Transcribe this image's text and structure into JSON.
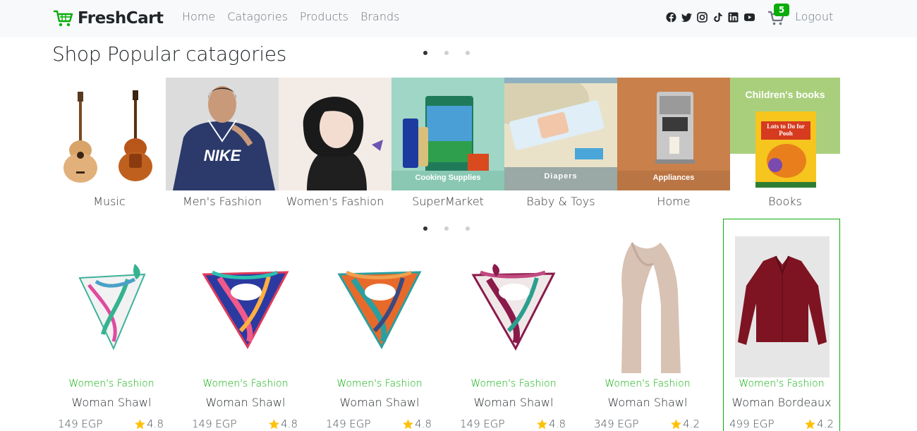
{
  "brand": {
    "name": "FreshCart"
  },
  "nav": {
    "links": [
      "Home",
      "Catagories",
      "Products",
      "Brands"
    ],
    "logout": "Logout"
  },
  "social_icons": [
    "facebook-icon",
    "twitter-icon",
    "instagram-icon",
    "tiktok-icon",
    "linkedin-icon",
    "youtube-icon"
  ],
  "cart": {
    "count": "5"
  },
  "colors": {
    "accent": "#0aad0a",
    "navbar_bg": "#f8f9fa",
    "star": "#ffc107"
  },
  "categories_section": {
    "title": "Shop Popular catagories",
    "categories": [
      {
        "label": "Music"
      },
      {
        "label": "Men's Fashion",
        "overlay": "NIKE"
      },
      {
        "label": "Women's Fashion"
      },
      {
        "label": "SuperMarket",
        "overlay": "Cooking Supplies"
      },
      {
        "label": "Baby & Toys",
        "overlay": "Diapers"
      },
      {
        "label": "Home",
        "overlay": "Appliances"
      },
      {
        "label": "Books",
        "overlay": "Children's books",
        "book_title": "Lots to Do for Pooh"
      }
    ]
  },
  "products": [
    {
      "category": "Women's Fashion",
      "name": "Woman Shawl",
      "price": "149 EGP",
      "rating": "4.8"
    },
    {
      "category": "Women's Fashion",
      "name": "Woman Shawl",
      "price": "149 EGP",
      "rating": "4.8"
    },
    {
      "category": "Women's Fashion",
      "name": "Woman Shawl",
      "price": "149 EGP",
      "rating": "4.8"
    },
    {
      "category": "Women's Fashion",
      "name": "Woman Shawl",
      "price": "149 EGP",
      "rating": "4.8"
    },
    {
      "category": "Women's Fashion",
      "name": "Woman Shawl",
      "price": "349 EGP",
      "rating": "4.2"
    },
    {
      "category": "Women's Fashion",
      "name": "Woman Bordeaux",
      "price": "499 EGP",
      "rating": "4.2"
    }
  ]
}
